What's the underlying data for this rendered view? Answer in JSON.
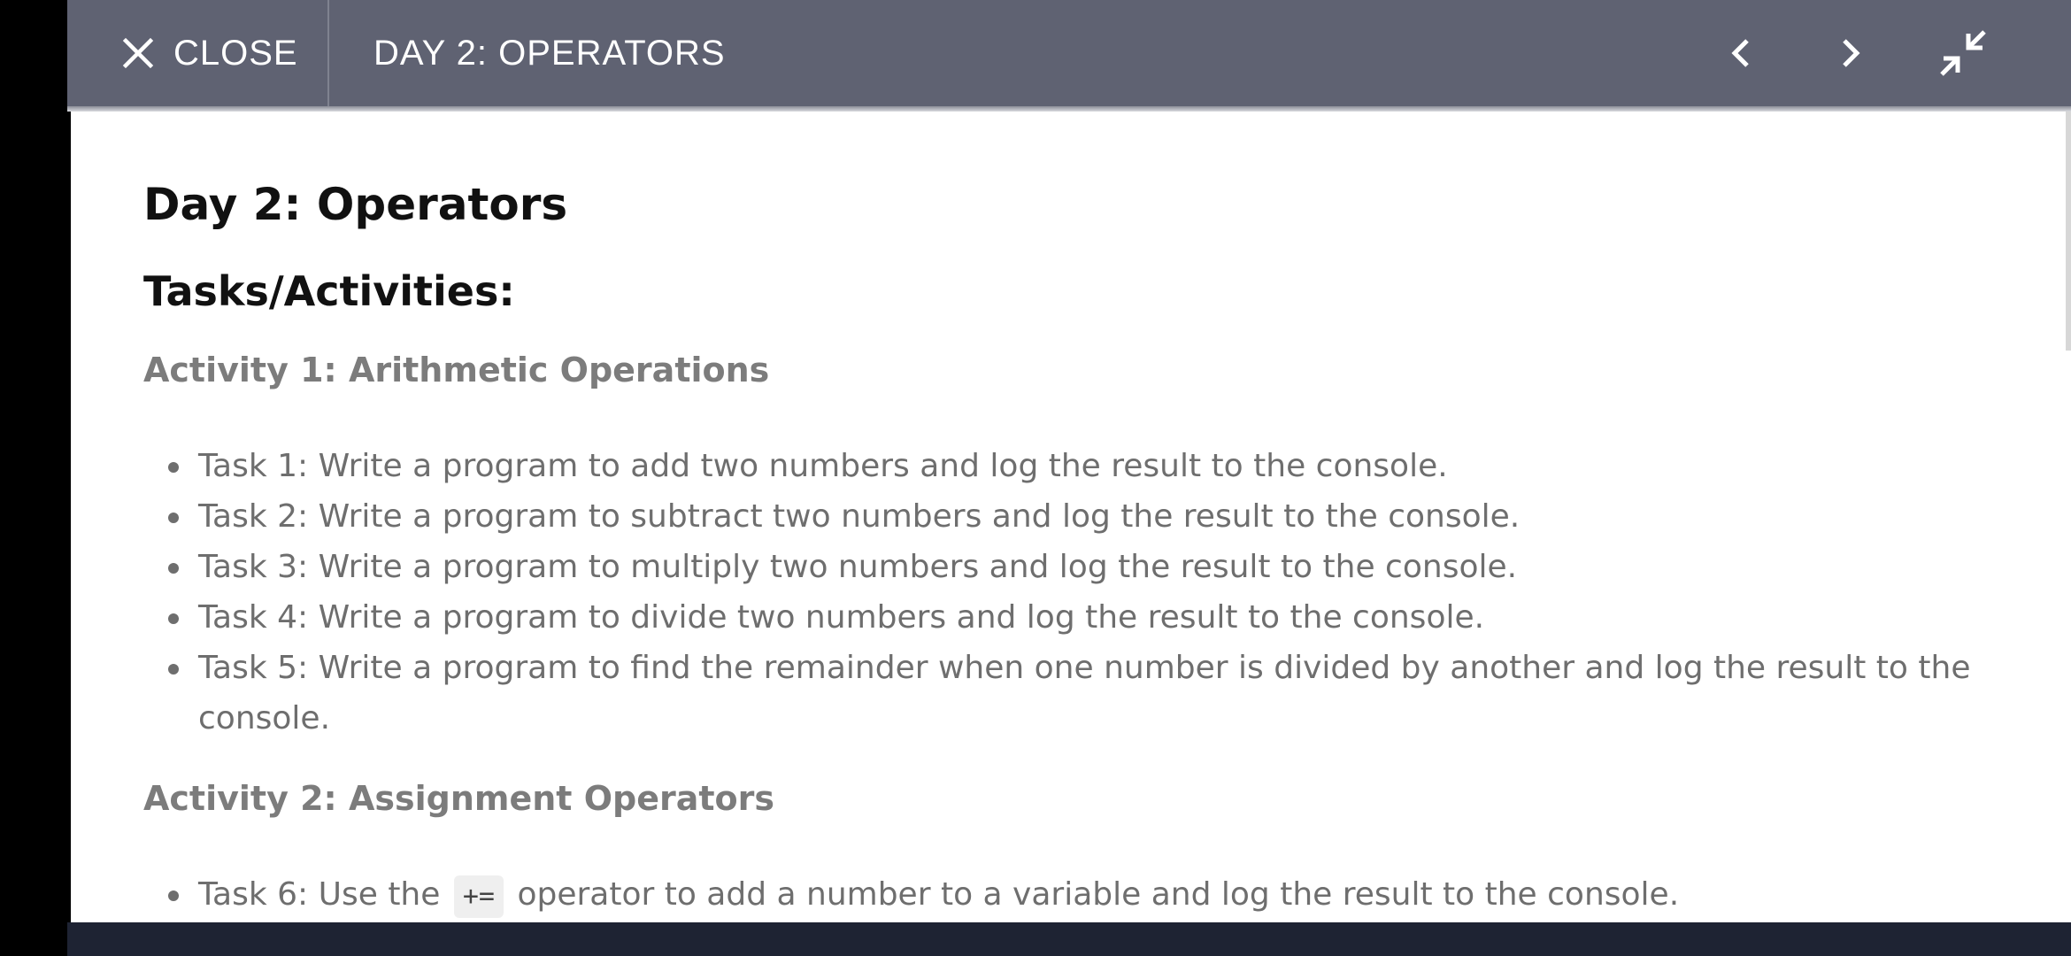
{
  "toolbar": {
    "close_label": "CLOSE",
    "title": "DAY 2: OPERATORS",
    "icons": [
      "close-icon",
      "chevron-left-icon",
      "chevron-right-icon",
      "minimize-icon",
      "more-vertical-icon"
    ]
  },
  "colors": {
    "toolbar_bg": "#5f6272",
    "bottom_bar": "#1e2333",
    "heading_text": "#111111",
    "body_text": "#6e6e6e"
  },
  "document": {
    "title": "Day 2: Operators",
    "section_heading": "Tasks/Activities:",
    "activities": [
      {
        "heading": "Activity 1: Arithmetic Operations",
        "tasks": [
          "Task 1: Write a program to add two numbers and log the result to the console.",
          "Task 2: Write a program to subtract two numbers and log the result to the console.",
          "Task 3: Write a program to multiply two numbers and log the result to the console.",
          "Task 4: Write a program to divide two numbers and log the result to the console.",
          "Task 5: Write a program to find the remainder when one number is divided by another and log the result to the console."
        ]
      },
      {
        "heading": "Activity 2: Assignment Operators",
        "task6": {
          "prefix": "Task 6: Use the",
          "code": "+=",
          "suffix": "operator to add a number to a variable and log the result to the console."
        }
      }
    ]
  }
}
